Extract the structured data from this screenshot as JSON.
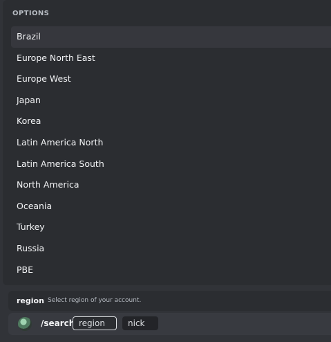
{
  "options_popout": {
    "header": "OPTIONS",
    "items": [
      {
        "label": "Brazil"
      },
      {
        "label": "Europe North East"
      },
      {
        "label": "Europe West"
      },
      {
        "label": "Japan"
      },
      {
        "label": "Korea"
      },
      {
        "label": "Latin America North"
      },
      {
        "label": "Latin America South"
      },
      {
        "label": "North America"
      },
      {
        "label": "Oceania"
      },
      {
        "label": "Turkey"
      },
      {
        "label": "Russia"
      },
      {
        "label": "PBE"
      }
    ],
    "selected_label": "Brazil"
  },
  "option_hint": {
    "name": "region",
    "description": "Select region of your account."
  },
  "command_input": {
    "command": "/search",
    "options": [
      {
        "label": "region",
        "active": true
      },
      {
        "label": "nick",
        "active": false
      }
    ]
  },
  "colors": {
    "background": "#313338",
    "popout": "#2b2d31",
    "selected_item": "#36373d",
    "text": "#f2f3f5",
    "muted_text": "#b5bac1"
  }
}
